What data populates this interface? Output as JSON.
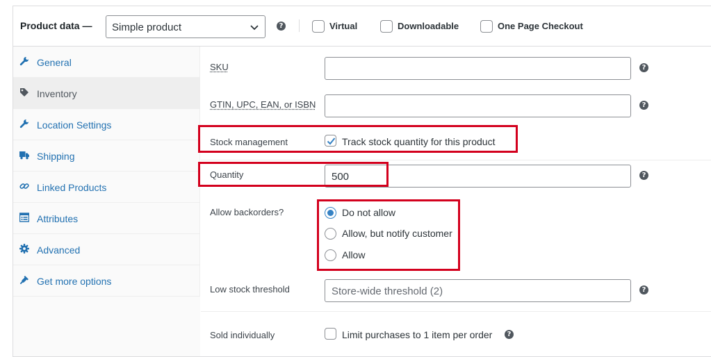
{
  "header": {
    "title": "Product data —",
    "product_type": "Simple product",
    "checkboxes": [
      {
        "label": "Virtual",
        "checked": false
      },
      {
        "label": "Downloadable",
        "checked": false
      },
      {
        "label": "One Page Checkout",
        "checked": false
      }
    ]
  },
  "sidebar": {
    "items": [
      {
        "label": "General",
        "icon": "wrench-icon",
        "active": false
      },
      {
        "label": "Inventory",
        "icon": "tag-icon",
        "active": true
      },
      {
        "label": "Location Settings",
        "icon": "wrench-icon",
        "active": false
      },
      {
        "label": "Shipping",
        "icon": "truck-icon",
        "active": false
      },
      {
        "label": "Linked Products",
        "icon": "link-icon",
        "active": false
      },
      {
        "label": "Attributes",
        "icon": "list-icon",
        "active": false
      },
      {
        "label": "Advanced",
        "icon": "gear-icon",
        "active": false
      },
      {
        "label": "Get more options",
        "icon": "plugin-icon",
        "active": false
      }
    ]
  },
  "form": {
    "sku": {
      "label": "SKU",
      "value": ""
    },
    "gtin": {
      "label": "GTIN, UPC, EAN, or ISBN",
      "value": ""
    },
    "stock_management": {
      "label": "Stock management",
      "checkbox_label": "Track stock quantity for this product",
      "checked": true
    },
    "quantity": {
      "label": "Quantity",
      "value": "500"
    },
    "backorders": {
      "label": "Allow backorders?",
      "options": [
        {
          "label": "Do not allow",
          "selected": true
        },
        {
          "label": "Allow, but notify customer",
          "selected": false
        },
        {
          "label": "Allow",
          "selected": false
        }
      ]
    },
    "low_stock": {
      "label": "Low stock threshold",
      "placeholder": "Store-wide threshold (2)"
    },
    "sold_individually": {
      "label": "Sold individually",
      "checkbox_label": "Limit purchases to 1 item per order",
      "checked": false
    }
  },
  "help_glyph": "?",
  "colors": {
    "link": "#2271b1",
    "highlight": "#d3001d",
    "accent": "#3582c4"
  }
}
